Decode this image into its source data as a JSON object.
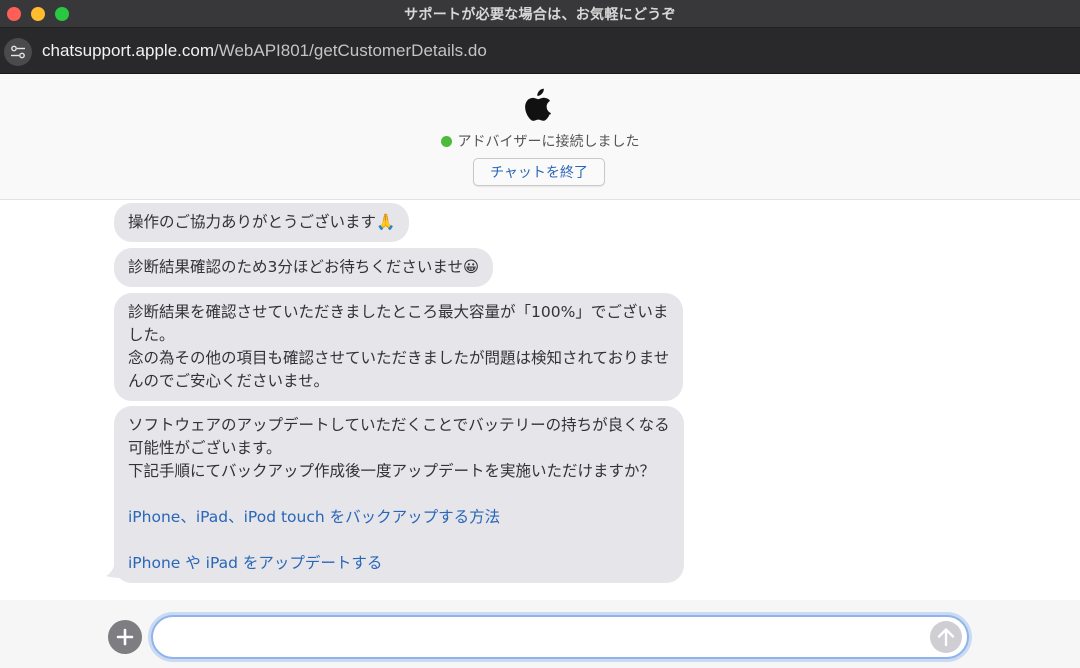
{
  "window": {
    "title": "サポートが必要な場合は、お気軽にどうぞ"
  },
  "urlbar": {
    "host": "chatsupport.apple.com",
    "path": "/WebAPI801/getCustomerDetails.do"
  },
  "header": {
    "status_text": "アドバイザーに接続しました",
    "end_chat_label": "チャットを終了",
    "status_color": "#4dba3a"
  },
  "messages": [
    {
      "lines": [
        "操作のご協力ありがとうございます🙏"
      ]
    },
    {
      "lines": [
        "診断結果確認のため3分ほどお待ちくださいませ😀"
      ]
    },
    {
      "lines": [
        "診断結果を確認させていただきましたところ最大容量が「100%」でございま",
        "した。",
        "念の為その他の項目も確認させていただきましたが問題は検知されておりませ",
        "んのでご安心くださいませ。"
      ]
    },
    {
      "lines": [
        "ソフトウェアのアップデートしていただくことでバッテリーの持ちが良くなる",
        "可能性がございます。",
        "下記手順にてバックアップ作成後一度アップデートを実施いただけますか？"
      ],
      "links": [
        "iPhone、iPad、iPod touch をバックアップする方法",
        "iPhone や iPad をアップデートする"
      ]
    }
  ],
  "composer": {
    "input_value": "",
    "add_icon": "plus-icon",
    "send_icon": "arrow-up-icon"
  },
  "colors": {
    "link": "#2a66b8",
    "bubble": "#e5e5ea"
  }
}
